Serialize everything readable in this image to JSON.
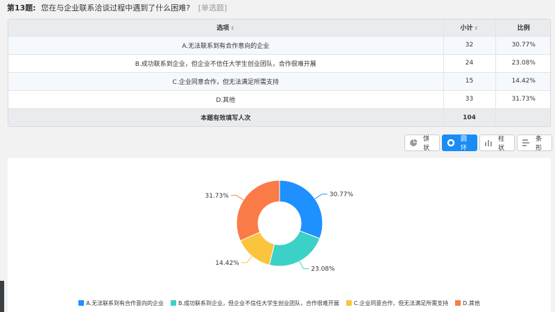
{
  "question": {
    "number": "第13题:",
    "text": "您在与企业联系洽谈过程中遇到了什么困难?",
    "type": "[单选题]"
  },
  "table": {
    "headers": {
      "option": "选项",
      "count": "小计",
      "ratio": "比例"
    },
    "rows": [
      {
        "option": "A.无法联系到有合作意向的企业",
        "count": "32",
        "ratio": "30.77%"
      },
      {
        "option": "B.成功联系到企业，但企业不信任大学生创业团队，合作很难开展",
        "count": "24",
        "ratio": "23.08%"
      },
      {
        "option": "C.企业同意合作，但无法满足所需支持",
        "count": "15",
        "ratio": "14.42%"
      },
      {
        "option": "D.其他",
        "count": "33",
        "ratio": "31.73%"
      }
    ],
    "footer": {
      "label": "本题有效填写人次",
      "count": "104",
      "ratio": ""
    }
  },
  "toolbar": {
    "pie": "饼状",
    "donut": "圆环",
    "bar": "柱状",
    "hbar": "条形",
    "active": "donut"
  },
  "chart_data": {
    "type": "pie",
    "variant": "donut",
    "categories": [
      "A.无法联系到有合作意向的企业",
      "B.成功联系到企业，但企业不信任大学生创业团队，合作很难开展",
      "C.企业同意合作，但无法满足所需支持",
      "D.其他"
    ],
    "values": [
      30.77,
      23.08,
      14.42,
      31.73
    ],
    "labels": [
      "30.77%",
      "23.08%",
      "14.42%",
      "31.73%"
    ],
    "colors": [
      "#1e90ff",
      "#3cd1c6",
      "#fbc43e",
      "#fa7b47"
    ],
    "legend_position": "bottom"
  }
}
